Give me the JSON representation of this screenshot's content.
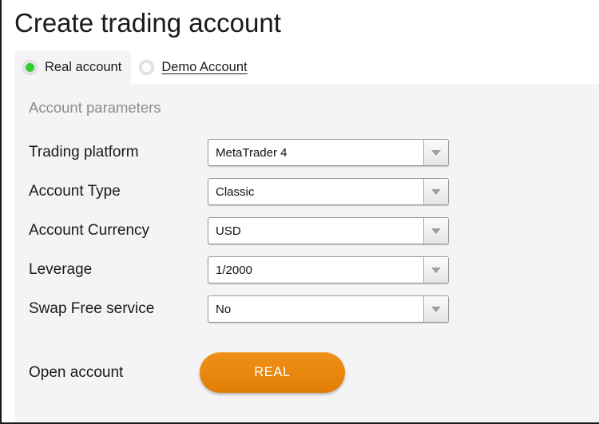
{
  "page": {
    "title": "Create trading account"
  },
  "tabs": [
    {
      "id": "real-account",
      "label": "Real account",
      "selected": true,
      "radio_color": "#33cc33",
      "underlined": false
    },
    {
      "id": "demo-account",
      "label": "Demo Account",
      "selected": false,
      "radio_color": "#ffffff",
      "underlined": true
    }
  ],
  "panel": {
    "section_title": "Account parameters",
    "background": "#f4f4f6",
    "fields": [
      {
        "id": "trading-platform",
        "label": "Trading platform",
        "value": "MetaTrader 4"
      },
      {
        "id": "account-type",
        "label": "Account Type",
        "value": "Classic"
      },
      {
        "id": "account-currency",
        "label": "Account Currency",
        "value": "USD"
      },
      {
        "id": "leverage",
        "label": "Leverage",
        "value": "1/2000"
      },
      {
        "id": "swap-free-service",
        "label": "Swap Free service",
        "value": "No"
      }
    ],
    "open_account": {
      "label": "Open account",
      "button_label": "REAL",
      "button_color": "#e9860d"
    }
  },
  "icons": {
    "caret": "chevron-down-icon",
    "radio_on": "radio-selected-icon",
    "radio_off": "radio-unselected-icon"
  }
}
